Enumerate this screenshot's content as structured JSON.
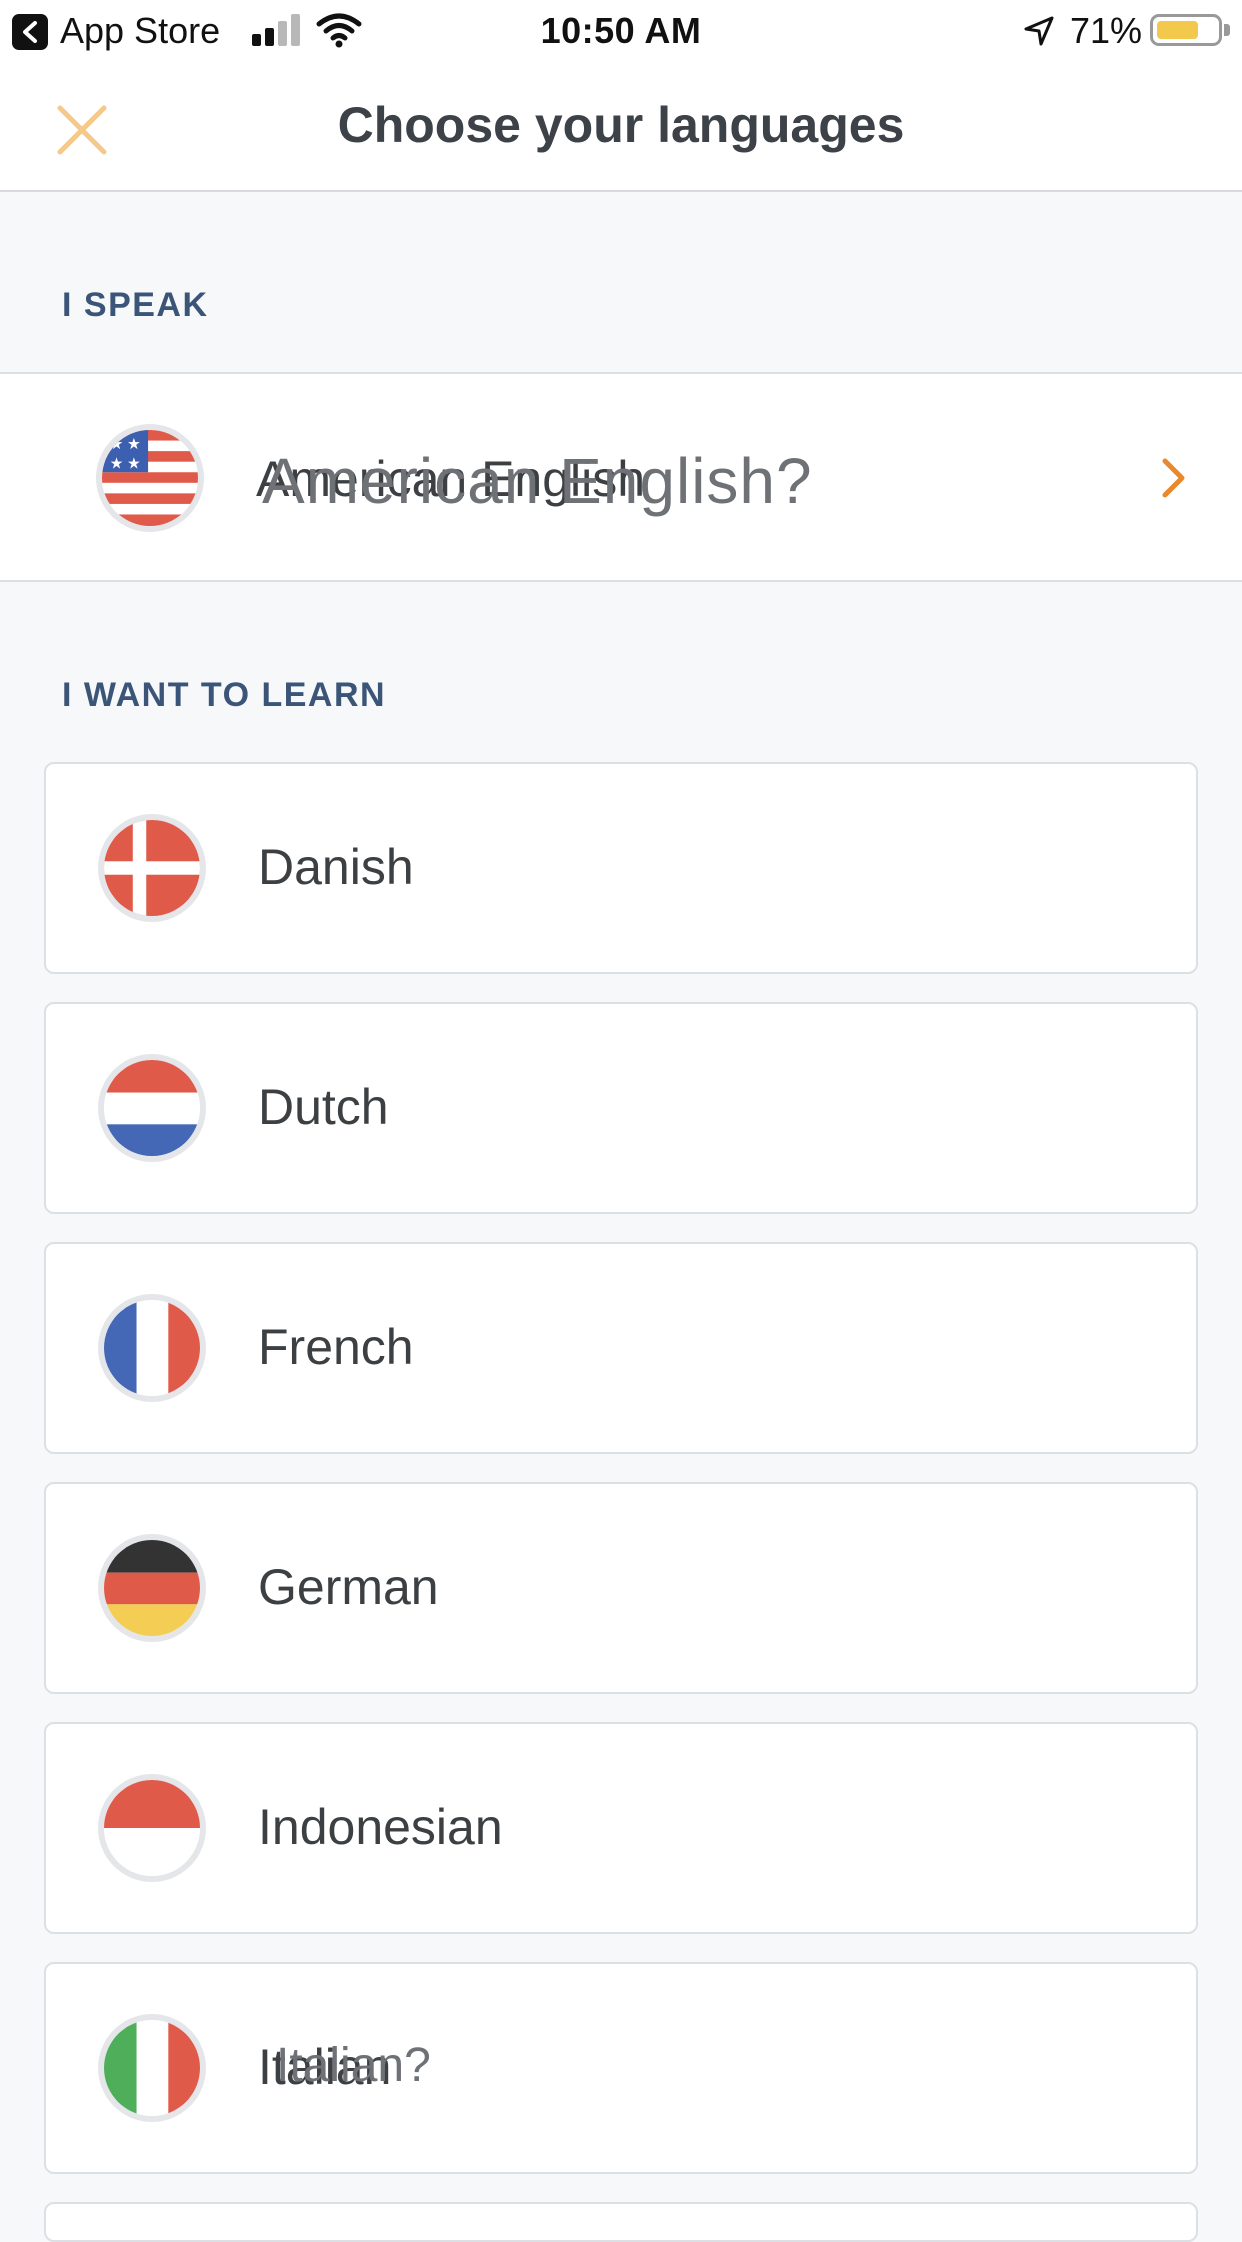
{
  "status_bar": {
    "back_app": "App Store",
    "time": "10:50 AM",
    "battery_percent": "71%",
    "battery_level": 0.71,
    "signal_icon": "cellular-signal-icon",
    "wifi_icon": "wifi-icon",
    "location_icon": "location-arrow-icon"
  },
  "header": {
    "title": "Choose your languages",
    "close_icon": "close-icon",
    "accent_color": "#f5c98a"
  },
  "speak_section": {
    "label": "I SPEAK",
    "language": "American English",
    "overlay_text": "American English?",
    "flag_icon": "us-flag-icon",
    "chevron_icon": "chevron-right-icon",
    "chevron_color": "#e8892b"
  },
  "learn_section": {
    "label": "I WANT TO LEARN",
    "languages": [
      {
        "label": "Danish",
        "flag": "danish-flag-icon"
      },
      {
        "label": "Dutch",
        "flag": "dutch-flag-icon"
      },
      {
        "label": "French",
        "flag": "french-flag-icon"
      },
      {
        "label": "German",
        "flag": "german-flag-icon"
      },
      {
        "label": "Indonesian",
        "flag": "indonesian-flag-icon"
      },
      {
        "label": "Italian",
        "flag": "italian-flag-icon",
        "overlay_text": "Italian?"
      }
    ]
  }
}
